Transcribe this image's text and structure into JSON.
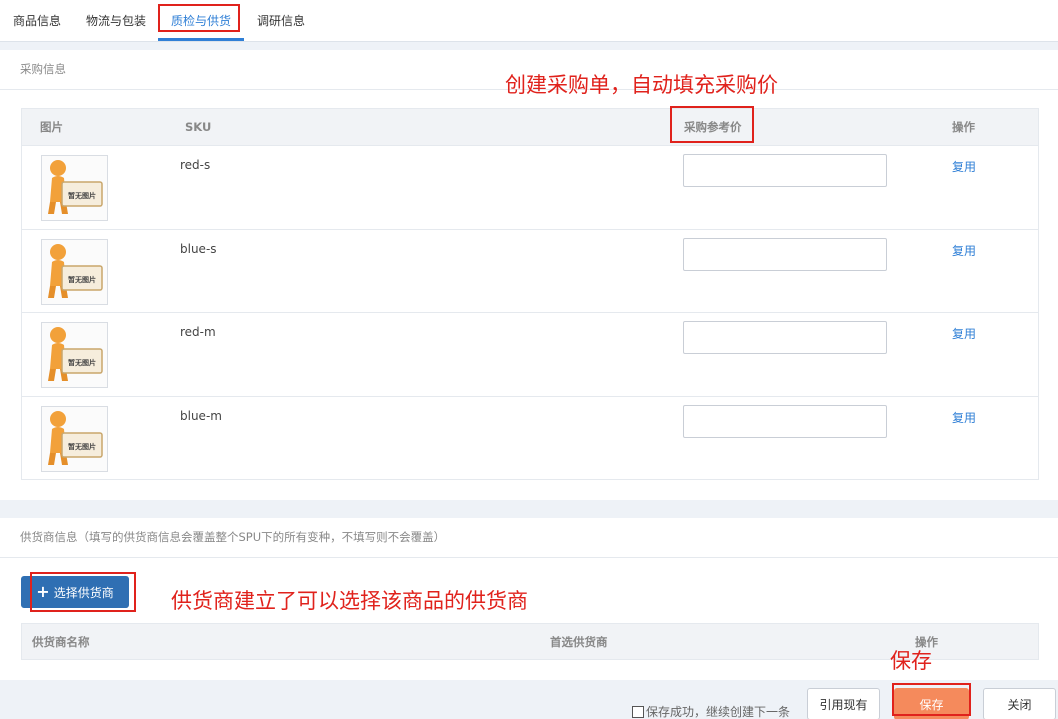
{
  "tabs": [
    {
      "label": "商品信息"
    },
    {
      "label": "物流与包装"
    },
    {
      "label": "质检与供货"
    },
    {
      "label": "调研信息"
    }
  ],
  "purchase": {
    "header": "采购信息",
    "columns": {
      "image": "图片",
      "sku": "SKU",
      "price": "采购参考价",
      "action": "操作"
    },
    "placeholder_text": "暂无图片",
    "reuse_label": "复用",
    "rows": [
      {
        "sku": "red-s",
        "price": ""
      },
      {
        "sku": "blue-s",
        "price": ""
      },
      {
        "sku": "red-m",
        "price": ""
      },
      {
        "sku": "blue-m",
        "price": ""
      }
    ]
  },
  "supplier": {
    "header": "供货商信息（填写的供货商信息会覆盖整个SPU下的所有变种，不填写则不会覆盖）",
    "select_button": "选择供货商",
    "columns": {
      "name": "供货商名称",
      "preferred": "首选供货商",
      "action": "操作"
    }
  },
  "footer": {
    "save_next": "保存成功，继续创建下一条",
    "cite_existing": "引用现有",
    "save": "保存",
    "close": "关闭"
  },
  "annotations": {
    "purchase_note": "创建采购单，自动填充采购价",
    "supplier_note": "供货商建立了可以选择该商品的供货商",
    "save_note": "保存"
  },
  "colors": {
    "accent": "#2f7fd6",
    "primary_button": "#2f6fb3",
    "save_button": "#f58a5c",
    "annotation": "#e0221c"
  }
}
